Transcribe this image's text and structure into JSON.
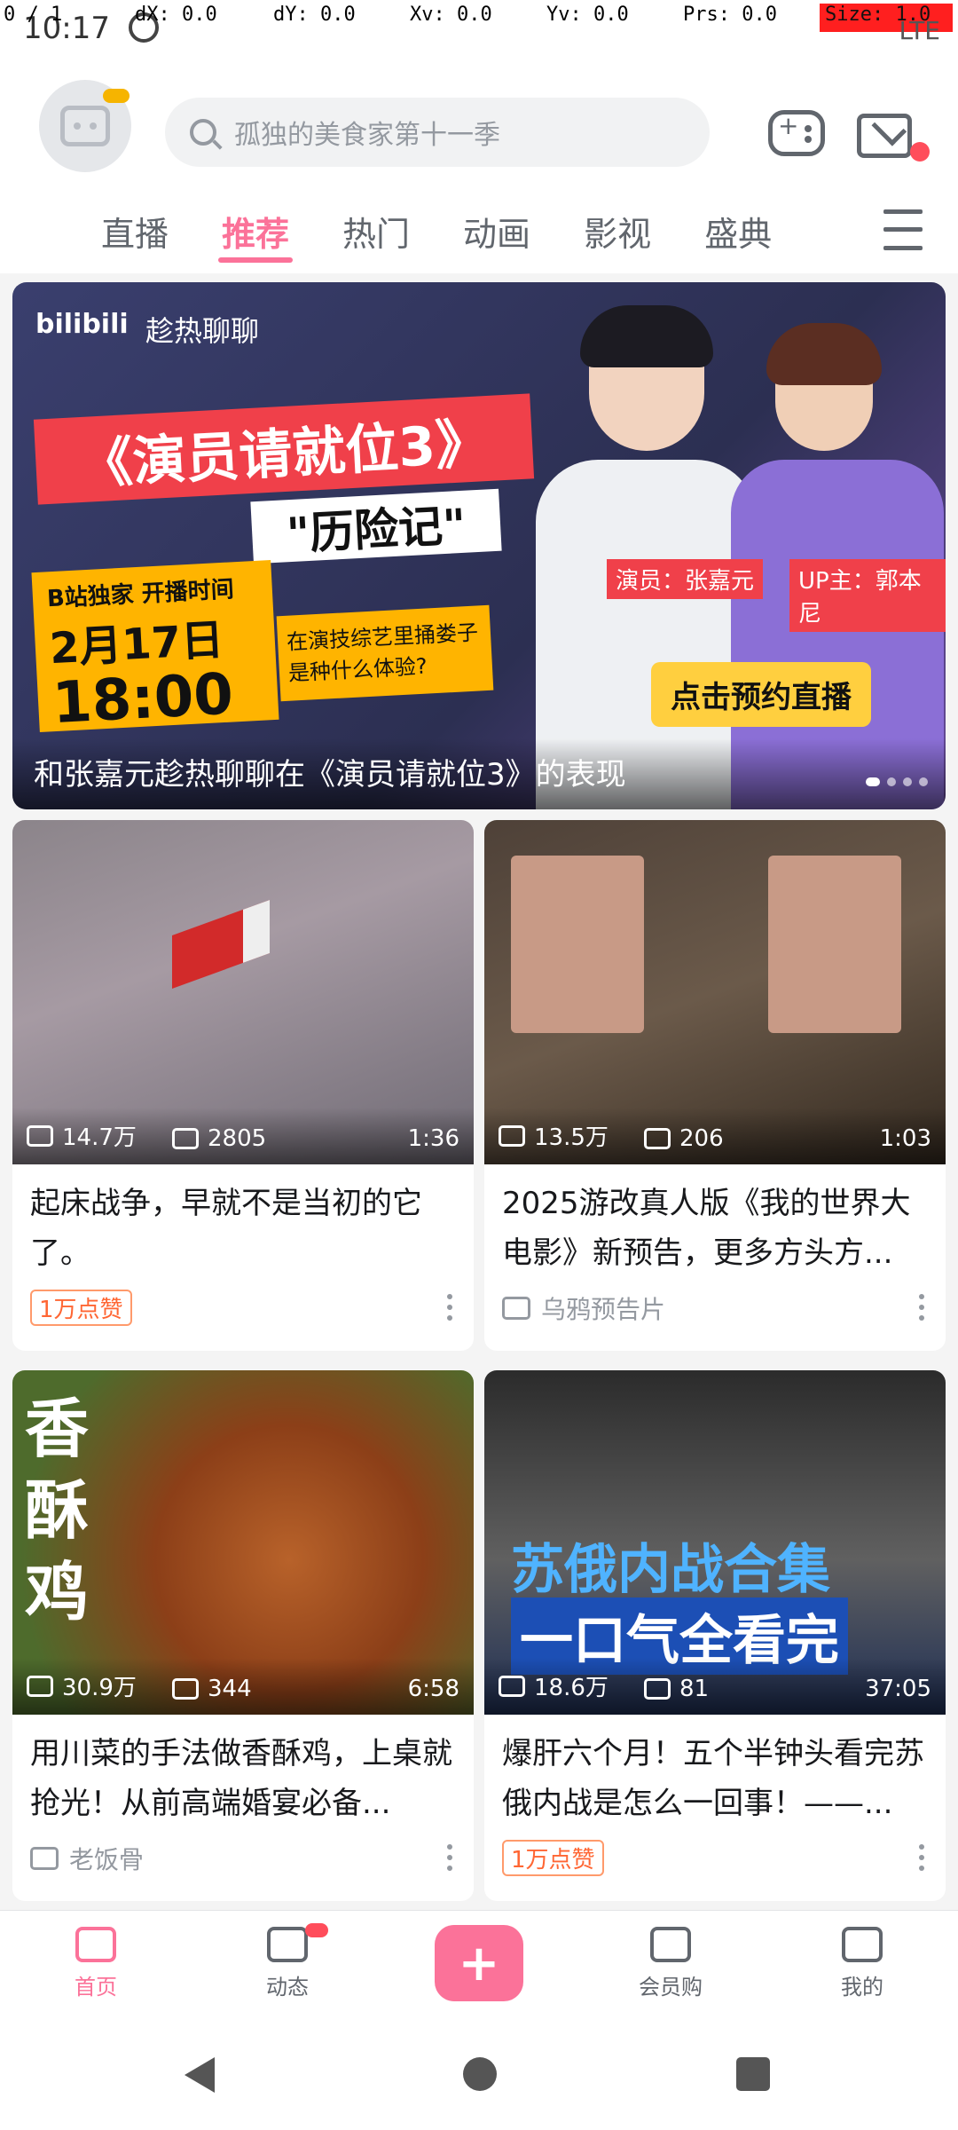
{
  "status_bar": {
    "time": "10:17",
    "debug": {
      "p": "0 / 1",
      "dx": "dX: 0.0",
      "dy": "dY: 0.0",
      "xv": "Xv: 0.0",
      "yv": "Yv: 0.0",
      "prs": "Prs: 0.0",
      "size": "Size: 1.0"
    },
    "network": "LTE"
  },
  "header": {
    "search_placeholder": "孤独的美食家第十一季"
  },
  "tabs": [
    {
      "label": "直播"
    },
    {
      "label": "推荐",
      "active": true
    },
    {
      "label": "热门"
    },
    {
      "label": "动画"
    },
    {
      "label": "影视"
    },
    {
      "label": "盛典"
    }
  ],
  "banner": {
    "logo": "bilibili",
    "sub": "趁热聊聊",
    "headline": "《演员请就位3》",
    "subhead": "\"历险记\"",
    "exclusive": "B站独家 开播时间",
    "date": "2月17日",
    "time": "18:00",
    "question": "在演技综艺里捅娄子是种什么体验?",
    "actor_tag": "演员：张嘉元",
    "up_tag": "UP主：郭本尼",
    "cta": "点击预约直播",
    "caption": "和张嘉元趁热聊聊在《演员请就位3》的表现"
  },
  "cards": [
    {
      "views": "14.7万",
      "danmaku": "2805",
      "duration": "1:36",
      "title": "起床战争，早就不是当初的它了。",
      "meta": "1万点赞",
      "meta_hot": true
    },
    {
      "views": "13.5万",
      "danmaku": "206",
      "duration": "1:03",
      "title": "2025游改真人版《我的世界大电影》新预告，更多方头方...",
      "meta": "乌鸦预告片",
      "meta_hot": false
    },
    {
      "views": "30.9万",
      "danmaku": "344",
      "duration": "6:58",
      "title": "用川菜的手法做香酥鸡，上桌就抢光！从前高端婚宴必备...",
      "meta": "老饭骨",
      "meta_hot": false,
      "thumb_text": "香酥鸡"
    },
    {
      "views": "18.6万",
      "danmaku": "81",
      "duration": "37:05",
      "title": "爆肝六个月！五个半钟头看完苏俄内战是怎么一回事！——...",
      "meta": "1万点赞",
      "meta_hot": true,
      "thumb_text1": "苏俄内战合集",
      "thumb_text2": "一口气全看完"
    }
  ],
  "bottom_nav": [
    {
      "label": "首页",
      "active": true
    },
    {
      "label": "动态"
    },
    {
      "label": ""
    },
    {
      "label": "会员购"
    },
    {
      "label": "我的"
    }
  ]
}
